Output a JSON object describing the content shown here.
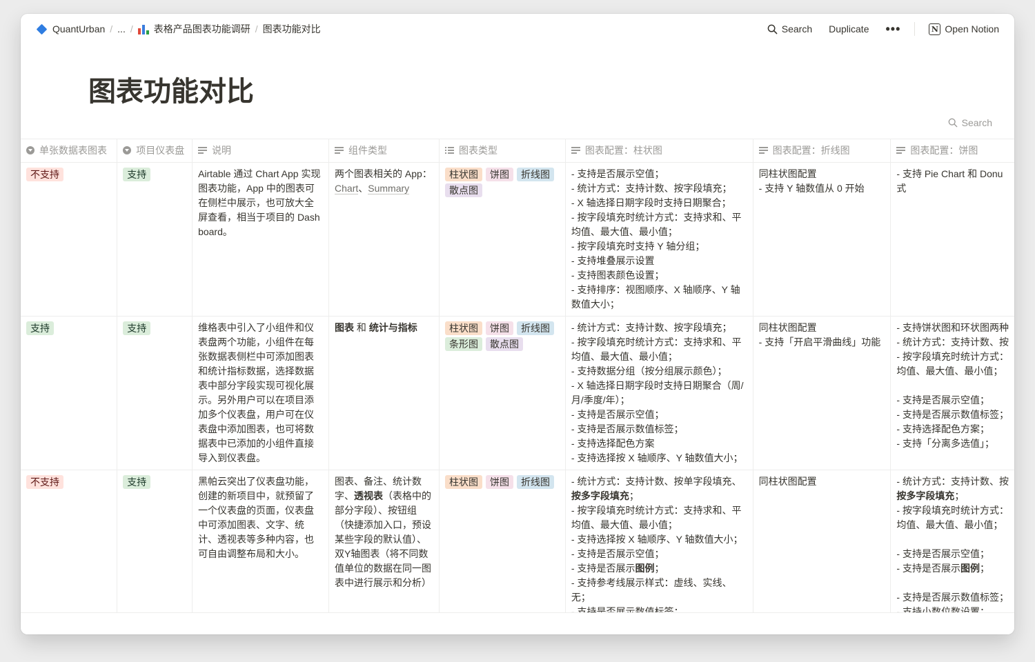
{
  "breadcrumb": {
    "workspace": "QuantUrban",
    "ellipsis": "...",
    "parent": "表格产品图表功能调研",
    "current": "图表功能对比"
  },
  "actions": {
    "search": "Search",
    "duplicate": "Duplicate",
    "more": "•••",
    "open_notion": "Open Notion"
  },
  "page": {
    "title": "图表功能对比"
  },
  "database": {
    "search_label": "Search"
  },
  "columns": [
    "单张数据表图表",
    "项目仪表盘",
    "说明",
    "组件类型",
    "图表类型",
    "图表配置：柱状图",
    "图表配置：折线图",
    "图表配置：饼图"
  ],
  "rows": [
    {
      "single_table": "不支持",
      "dashboard": "支持",
      "desc": "Airtable 通过 Chart App 实现图表功能，App 中的图表可在侧栏中展示，也可放大全屏查看，相当于项目的 Dashboard。",
      "component": {
        "prefix": "两个图表相关的 App：",
        "link1": "Chart",
        "sep": "、",
        "link2": "Summary"
      },
      "chart_types": [
        "柱状图",
        "饼图",
        "折线图",
        "散点图"
      ],
      "bar_cfg": [
        "- 支持是否展示空值；",
        "- 统计方式：支持计数、按字段填充；",
        "- X 轴选择日期字段时支持日期聚合；",
        "- 按字段填充时统计方式：支持求和、平",
        "均值、最大值、最小值；",
        "- 按字段填充时支持 Y 轴分组；",
        "- 支持堆叠展示设置",
        "- 支持图表颜色设置；",
        "- 支持排序：视图顺序、X 轴顺序、Y 轴",
        "数值大小；"
      ],
      "line_cfg": [
        "同柱状图配置",
        "- 支持 Y 轴数值从 0 开始"
      ],
      "pie_cfg": [
        "- 支持 Pie Chart 和 Donu",
        "式"
      ]
    },
    {
      "single_table": "支持",
      "dashboard": "支持",
      "desc": "维格表中引入了小组件和仪表盘两个功能，小组件在每张数据表侧栏中可添加图表和统计指标数据，选择数据表中部分字段实现可视化展示。另外用户可以在项目添加多个仪表盘，用户可在仪表盘中添加图表，也可将数据表中已添加的小组件直接导入到仪表盘。",
      "component": {
        "b1": "图表",
        "mid": " 和 ",
        "b2": "统计与指标"
      },
      "chart_types": [
        "柱状图",
        "饼图",
        "折线图",
        "条形图",
        "散点图"
      ],
      "bar_cfg": [
        "- 统计方式：支持计数、按字段填充；",
        "- 按字段填充时统计方式：支持求和、平",
        "均值、最大值、最小值；",
        "- 支持数据分组（按分组展示颜色）；",
        "- X 轴选择日期字段时支持日期聚合（周/",
        "月/季度/年）；",
        "- 支持是否展示空值；",
        "- 支持是否展示数值标签；",
        "- 支持选择配色方案",
        "- 支持选择按 X 轴顺序、Y 轴数值大小；"
      ],
      "line_cfg": [
        "同柱状图配置",
        "- 支持「开启平滑曲线」功能"
      ],
      "pie_cfg": [
        "- 支持饼状图和环状图两种",
        "- 统计方式：支持计数、按",
        "- 按字段填充时统计方式：",
        "均值、最大值、最小值；",
        "",
        "- 支持是否展示空值；",
        "- 支持是否展示数值标签；",
        "- 支持选择配色方案；",
        "- 支持「分离多选值」；"
      ]
    },
    {
      "single_table": "不支持",
      "dashboard": "支持",
      "desc": "黑帕云突出了仪表盘功能，创建的新项目中，就预留了一个仪表盘的页面，仪表盘中可添加图表、文字、统计、透视表等多种内容，也可自由调整布局和大小。",
      "component": {
        "a": "图表、备注、统计数字、",
        "b": "透视表",
        "c": "（表格中的部分字段）、按钮组（快捷添加入口，预设某些字段的默认值）、双Y轴图表（将不同数值单位的数据在同一图表中进行展示和分析）"
      },
      "chart_types": [
        "柱状图",
        "饼图",
        "折线图"
      ],
      "bar_cfg": {
        "l1": "- 统计方式：支持计数、按单字段填充、",
        "l2b": "按多字段填充",
        "l2": "；",
        "l3": "- 按字段填充时统计方式：支持求和、平",
        "l4": "均值、最大值、最小值；",
        "l5": "- 支持选择按 X 轴顺序、Y 轴数值大小；",
        "l6": "- 支持是否展示空值；",
        "l7a": "- 支持是否展示",
        "l7b": "图例",
        "l7c": "；",
        "l8": "- 支持参考线展示样式：虚线、实线、",
        "l9": "无；",
        "l10": "- 支持是否展示数值标签；"
      },
      "line_cfg": [
        "同柱状图配置"
      ],
      "pie_cfg": {
        "l1": "- 统计方式：支持计数、按",
        "l2b": "按多字段填充",
        "l2": "；",
        "l3": "- 按字段填充时统计方式：",
        "l4": "均值、最大值、最小值；",
        "l6": "- 支持是否展示空值；",
        "l7a": "- 支持是否展示",
        "l7b": "图例",
        "l7c": "；",
        "l9": "- 支持是否展示数值标签；",
        "l10": "- 支持小数位数设置；"
      }
    }
  ],
  "colors": {
    "not_supported_bg": "#ffe2dd",
    "not_supported_fg": "#5d1715",
    "supported_bg": "#dbeddb",
    "supported_fg": "#1c3829",
    "tag_orange": "#fadec9",
    "tag_pink": "#f5e0e9",
    "tag_blue": "#d3e5ef",
    "tag_purple": "#e8deee",
    "tag_green": "#dbeddb"
  }
}
